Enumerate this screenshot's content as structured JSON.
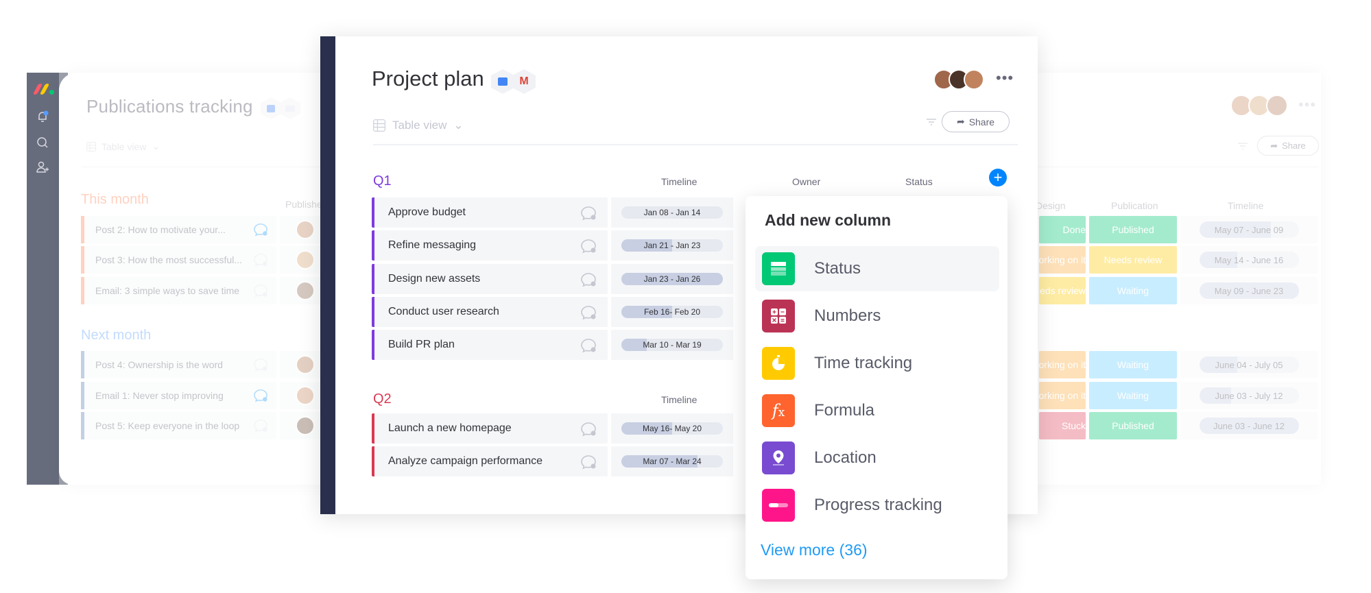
{
  "background_board": {
    "title": "Publications tracking",
    "view_label": "Table view",
    "share_label": "Share",
    "more_label": "•••",
    "publisher_header": "Publisher",
    "design_header": "Design",
    "publication_header": "Publication",
    "timeline_header": "Timeline",
    "groups": [
      {
        "title": "This month",
        "color": "#ff7f50",
        "rows": [
          {
            "name": "Post 2: How to motivate your...",
            "has_comment": true,
            "design": "Done",
            "design_color": "#00c875",
            "publication": "Published",
            "publication_color": "#00c875",
            "timeline": "May 07 - June 09",
            "progress": 0.72
          },
          {
            "name": "Post 3: How the most successful...",
            "has_comment": false,
            "design": "Working on it",
            "design_color": "#fdab3d",
            "publication": "Needs review",
            "publication_color": "#ffcb00",
            "timeline": "May 14 - June 16",
            "progress": 0.38
          },
          {
            "name": "Email: 3 simple ways to save time",
            "has_comment": false,
            "design": "Needs review",
            "design_color": "#ffcb00",
            "publication": "Waiting",
            "publication_color": "#66ccff",
            "timeline": "May 09 - June 23",
            "progress": 1.0
          }
        ]
      },
      {
        "title": "Next month",
        "color": "#579bfc",
        "rows": [
          {
            "name": "Post 4: Ownership is the word",
            "has_comment": false,
            "design": "Working on it",
            "design_color": "#fdab3d",
            "publication": "Waiting",
            "publication_color": "#66ccff",
            "timeline": "June 04 - July 05",
            "progress": 0.38
          },
          {
            "name": "Email 1: Never stop improving",
            "has_comment": true,
            "design": "Working on it",
            "design_color": "#fdab3d",
            "publication": "Waiting",
            "publication_color": "#66ccff",
            "timeline": "June 03 - July 12",
            "progress": 0.32
          },
          {
            "name": "Post 5: Keep everyone in the loop",
            "has_comment": false,
            "design": "Stuck",
            "design_color": "#e2445c",
            "publication": "Published",
            "publication_color": "#00c875",
            "timeline": "June 03 - June 12",
            "progress": 1.0
          }
        ]
      }
    ]
  },
  "sidebar": {
    "icons": [
      "monday-logo",
      "bell-icon",
      "search-icon",
      "add-user-icon"
    ]
  },
  "main_board": {
    "title": "Project plan",
    "view_label": "Table view",
    "share_label": "Share",
    "more_label": "•••",
    "add_column_label": "+",
    "columns": {
      "timeline": "Timeline",
      "owner": "Owner",
      "status": "Status"
    },
    "groups": [
      {
        "title": "Q1",
        "color": "#7e3bdd",
        "rows": [
          {
            "name": "Approve budget",
            "timeline": "Jan 08 - Jan 14",
            "progress": 0.0
          },
          {
            "name": "Refine messaging",
            "timeline": "Jan 21 - Jan 23",
            "progress": 0.5
          },
          {
            "name": "Design new assets",
            "timeline": "Jan 23 - Jan 26",
            "progress": 1.0
          },
          {
            "name": "Conduct user research",
            "timeline": "Feb 16- Feb 20",
            "progress": 0.5
          },
          {
            "name": "Build PR plan",
            "timeline": "Mar 10 - Mar 19",
            "progress": 0.25
          }
        ]
      },
      {
        "title": "Q2",
        "color": "#d83a52",
        "rows": [
          {
            "name": "Launch a new homepage",
            "timeline": "May 16- May 20",
            "progress": 0.5
          },
          {
            "name": "Analyze campaign performance",
            "timeline": "Mar 07 - Mar 24",
            "progress": 0.75
          }
        ]
      }
    ]
  },
  "popup": {
    "title": "Add new column",
    "items": [
      {
        "label": "Status",
        "icon": "status-icon",
        "color": "#00c875",
        "highlighted": true
      },
      {
        "label": "Numbers",
        "icon": "numbers-icon",
        "color": "#bb3354",
        "highlighted": false
      },
      {
        "label": "Time tracking",
        "icon": "time-tracking-icon",
        "color": "#ffcb00",
        "highlighted": false
      },
      {
        "label": "Formula",
        "icon": "formula-icon",
        "color": "#ff642e",
        "highlighted": false
      },
      {
        "label": "Location",
        "icon": "location-icon",
        "color": "#784bd1",
        "highlighted": false
      },
      {
        "label": "Progress tracking",
        "icon": "progress-tracking-icon",
        "color": "#ff158a",
        "highlighted": false
      }
    ],
    "view_more_label": "View more (36)"
  }
}
